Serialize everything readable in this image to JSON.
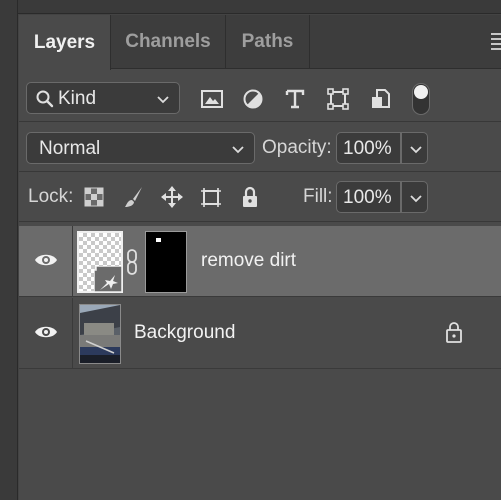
{
  "tabs": [
    {
      "label": "Layers",
      "active": true
    },
    {
      "label": "Channels",
      "active": false
    },
    {
      "label": "Paths",
      "active": false
    }
  ],
  "filter": {
    "kind_label": "Kind",
    "icons": [
      "image-filter-icon",
      "adjustment-filter-icon",
      "type-filter-icon",
      "shape-filter-icon",
      "smart-object-filter-icon"
    ]
  },
  "blend": {
    "mode": "Normal",
    "opacity_label": "Opacity:",
    "opacity_value": "100%"
  },
  "lock": {
    "label": "Lock:",
    "icons": [
      "lock-transparent-pixels-icon",
      "lock-image-pixels-icon",
      "lock-position-icon",
      "lock-artboard-icon",
      "lock-all-icon"
    ],
    "fill_label": "Fill:",
    "fill_value": "100%"
  },
  "layers": [
    {
      "name": "remove dirt",
      "visible": true,
      "selected": true,
      "type": "smart-object-with-mask"
    },
    {
      "name": "Background",
      "visible": true,
      "selected": false,
      "locked": true
    }
  ],
  "colors": {
    "panel_bg": "#4a4a4a",
    "selected_row": "#6b6b6b",
    "text": "#d6d6d6"
  }
}
